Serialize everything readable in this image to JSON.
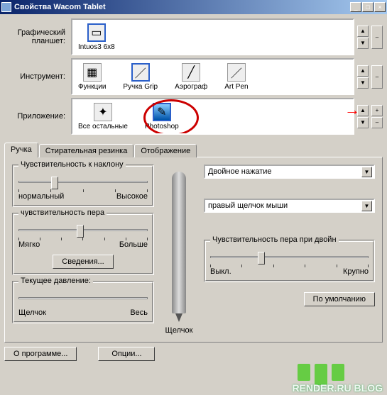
{
  "window": {
    "title": "Свойства Wacom Tablet"
  },
  "titlebtns": {
    "min": "_",
    "max": "□",
    "close": "×"
  },
  "selectors": {
    "tablet": {
      "label": "Графический планшет:",
      "items": [
        {
          "label": "Intuos3 6x8"
        }
      ]
    },
    "tool": {
      "label": "Инструмент:",
      "items": [
        {
          "label": "Функции"
        },
        {
          "label": "Ручка Grip"
        },
        {
          "label": "Аэрограф"
        },
        {
          "label": "Art Pen"
        }
      ]
    },
    "app": {
      "label": "Приложение:",
      "items": [
        {
          "label": "Все остальные"
        },
        {
          "label": "Photoshop"
        }
      ]
    },
    "plus": "+",
    "minus": "–",
    "up": "▲",
    "down": "▼"
  },
  "tabs": {
    "pen": "Ручка",
    "eraser": "Стирательная резинка",
    "mapping": "Отображение"
  },
  "tilt": {
    "title": "Чувствительность к наклону",
    "left": "нормальный",
    "right": "Высокое"
  },
  "tip": {
    "title": "чувствительность пера",
    "left": "Мягко",
    "right": "Больше",
    "details": "Сведения..."
  },
  "pressure": {
    "title": "Текущее давление:",
    "left": "Щелчок",
    "right": "Весь"
  },
  "penLabel": "Щелчок",
  "combo1": "Двойное нажатие",
  "combo2": "правый щелчок мыши",
  "dbl": {
    "title": "Чувствительность пера при двойн",
    "left": "Выкл.",
    "right": "Крупно"
  },
  "defaults": "По умолчанию",
  "about": "О программе...",
  "options": "Опции...",
  "watermark": "RENDER.RU BLOG"
}
